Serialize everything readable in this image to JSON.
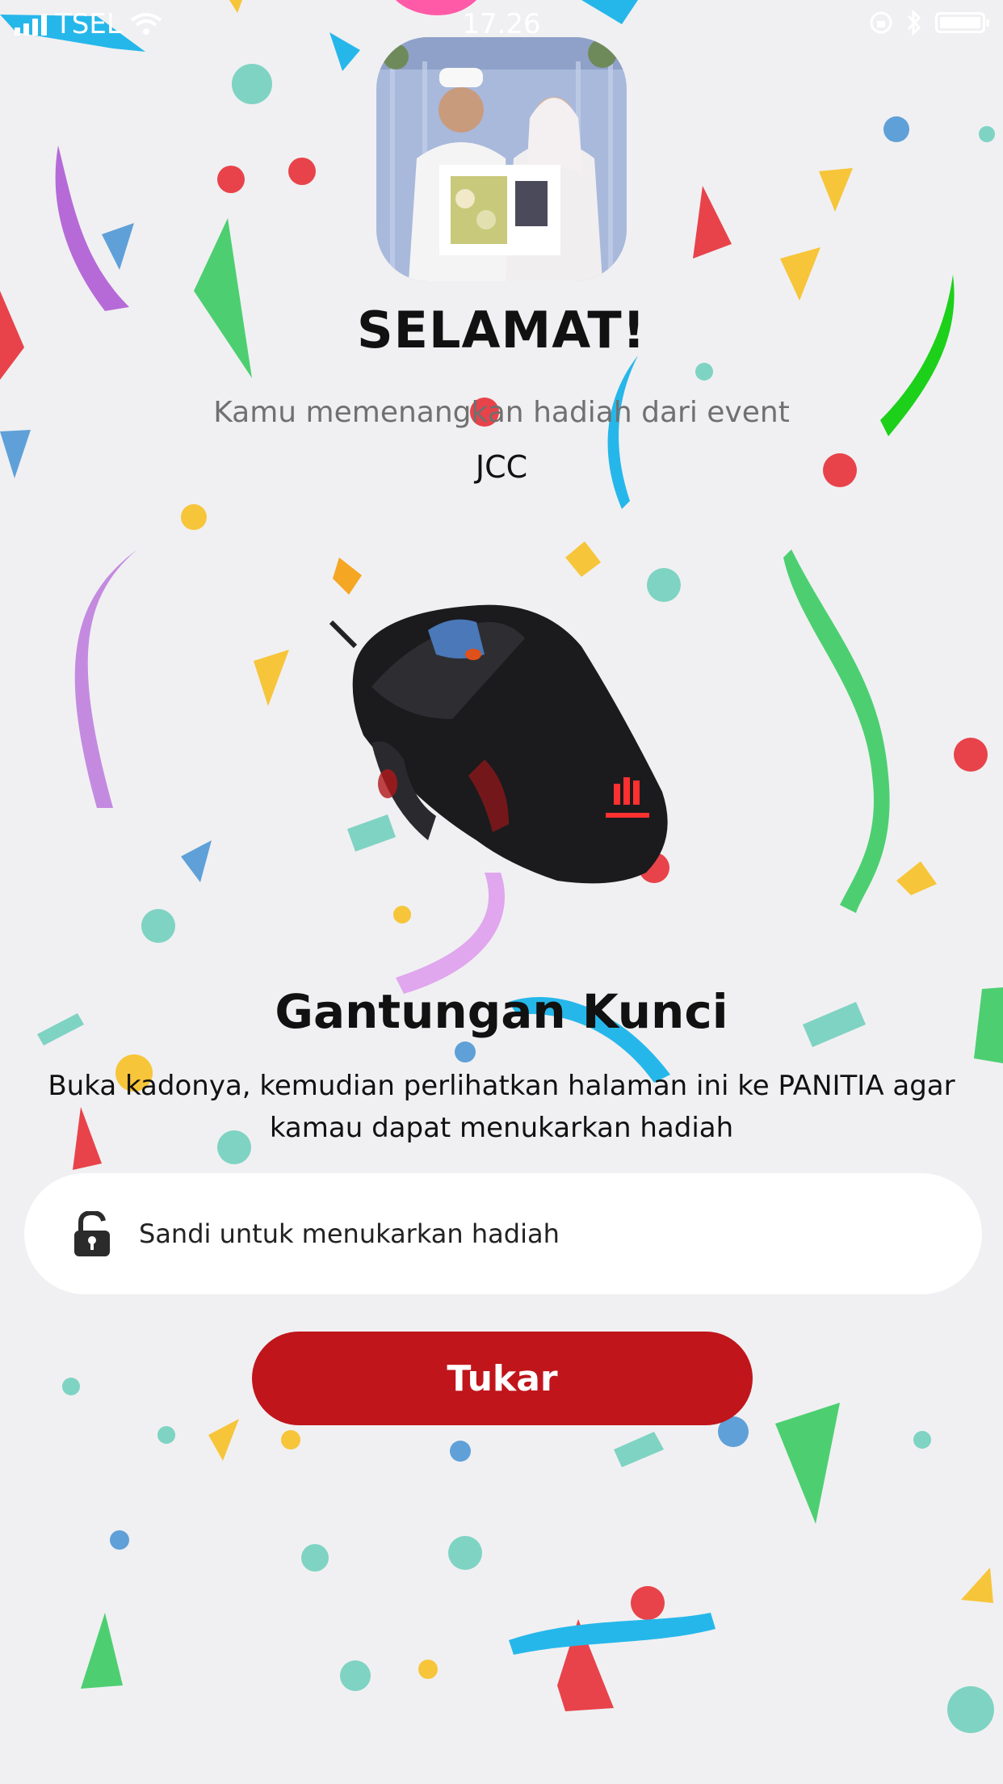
{
  "status_bar": {
    "carrier": "TSEL",
    "time": "17.26"
  },
  "icons": {
    "signal": "signal-bars-icon",
    "wifi": "wifi-icon",
    "rotation_lock": "rotation-lock-icon",
    "bluetooth": "bluetooth-icon",
    "battery": "battery-icon",
    "lock": "unlocked-padlock-icon"
  },
  "header": {
    "title": "SELAMAT!",
    "subtitle": "Kamu memenangkan hadiah dari event",
    "event_name": "JCC"
  },
  "prize": {
    "name": "Gantungan Kunci",
    "instructions": "Buka kadonya, kemudian perlihatkan halaman ini ke PANITIA agar kamau dapat menukarkan hadiah"
  },
  "redeem": {
    "password_placeholder": "Sandi untuk menukarkan hadiah",
    "password_value": "",
    "button_label": "Tukar"
  },
  "colors": {
    "background": "#f0f0f2",
    "button": "#c0151b",
    "button_text": "#ffffff",
    "subtitle_text": "#707070"
  }
}
